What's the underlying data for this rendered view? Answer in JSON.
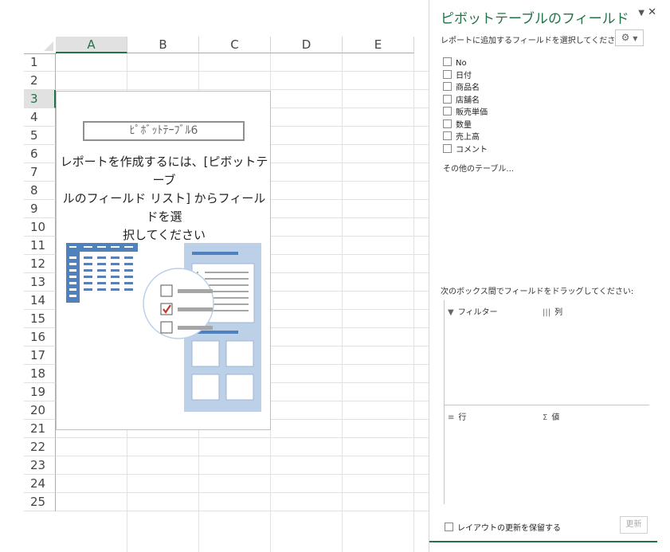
{
  "sheet": {
    "columns": [
      "A",
      "B",
      "C",
      "D",
      "E"
    ],
    "rows": [
      "1",
      "2",
      "3",
      "4",
      "5",
      "6",
      "7",
      "8",
      "9",
      "10",
      "11",
      "12",
      "13",
      "14",
      "15",
      "16",
      "17",
      "18",
      "19",
      "20",
      "21",
      "22",
      "23",
      "24",
      "25"
    ],
    "selected_column": "A",
    "selected_row": "3"
  },
  "pivot": {
    "name": "ﾋﾟﾎﾞｯﾄﾃｰﾌﾞﾙ6",
    "message_line1": "レポートを作成するには、[ピボットテーブ",
    "message_line2": "ルのフィールド リスト] からフィールドを選",
    "message_line3": "択してください"
  },
  "pane": {
    "title": "ピボットテーブルのフィールド",
    "subtitle": "レポートに追加するフィールドを選択してください:",
    "fields": [
      "No",
      "日付",
      "商品名",
      "店舗名",
      "販売単価",
      "数量",
      "売上高",
      "コメント"
    ],
    "other_tables": "その他のテーブル...",
    "drag_label": "次のボックス間でフィールドをドラッグしてください:",
    "zones": {
      "filter": "フィルター",
      "columns": "列",
      "rows": "行",
      "values": "値"
    },
    "defer_label": "レイアウトの更新を保留する",
    "update_label": "更新",
    "accent_color": "#217346"
  }
}
